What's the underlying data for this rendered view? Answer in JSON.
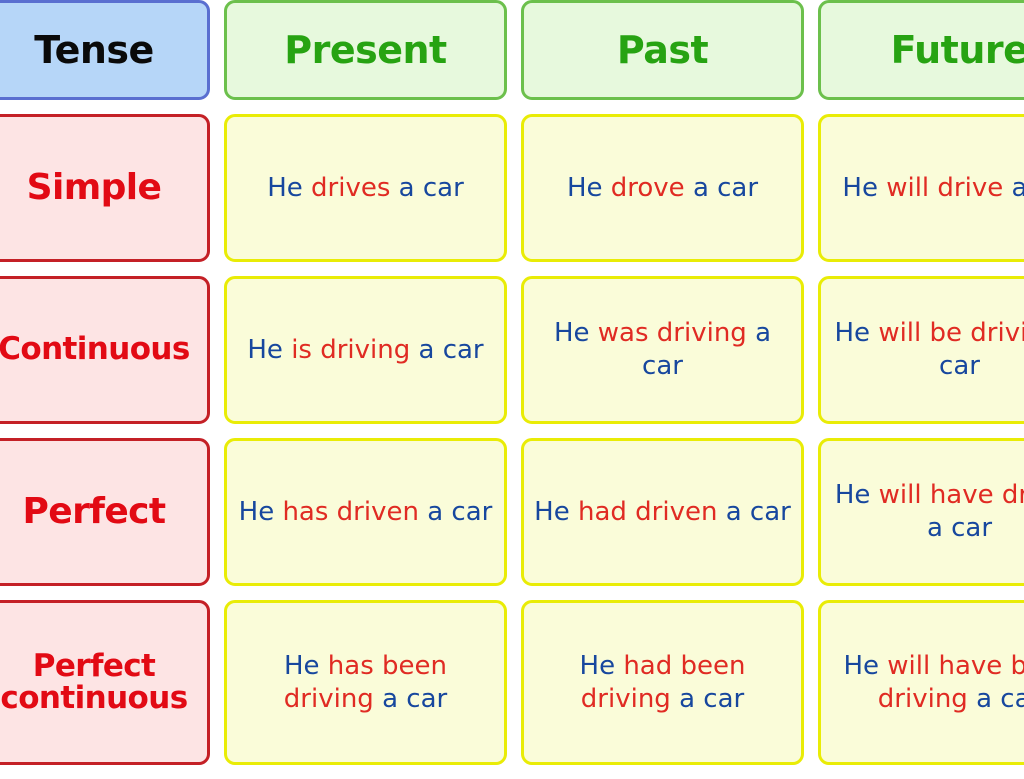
{
  "table": {
    "corner_label": "Tense",
    "columns": [
      "Present",
      "Past",
      "Future"
    ],
    "rows": [
      {
        "label": "Simple",
        "label_line2": "",
        "cells": [
          {
            "subject": "He ",
            "verb": "drives ",
            "object": "a car"
          },
          {
            "subject": "He ",
            "verb": "drove ",
            "object": "a car"
          },
          {
            "subject": "He ",
            "verb": "will drive ",
            "object": "a car"
          }
        ]
      },
      {
        "label": "Continuous",
        "label_line2": "",
        "cells": [
          {
            "subject": "He ",
            "verb": "is driving ",
            "object": "a car"
          },
          {
            "subject": "He ",
            "verb": "was driving ",
            "object": "a car"
          },
          {
            "subject": "He ",
            "verb": "will be driving ",
            "object": "a car"
          }
        ]
      },
      {
        "label": "Perfect",
        "label_line2": "",
        "cells": [
          {
            "subject": "He ",
            "verb": "has driven ",
            "object": "a car"
          },
          {
            "subject": "He ",
            "verb": "had driven ",
            "object": "a car"
          },
          {
            "subject": "He ",
            "verb": "will have driven ",
            "object": "a car"
          }
        ]
      },
      {
        "label": "Perfect",
        "label_line2": "continuous",
        "cells": [
          {
            "subject": "He ",
            "verb": "has been driving ",
            "object": "a car"
          },
          {
            "subject": "He ",
            "verb": "had been driving ",
            "object": "a car"
          },
          {
            "subject": "He ",
            "verb": "will have been driving ",
            "object": "a car"
          }
        ]
      }
    ]
  },
  "colors": {
    "corner_fill": "#b6d6f8",
    "corner_border": "#5a6fd0",
    "corner_text": "#0a0a0a",
    "column_head_fill": "#e7f9dd",
    "column_head_border": "#6cc04c",
    "column_head_text": "#27a312",
    "row_head_fill": "#fde4e4",
    "row_head_border": "#c42026",
    "row_head_text": "#e20a14",
    "sentence_fill": "#fafcd9",
    "sentence_border": "#e9ec06",
    "subject_text": "#17479e",
    "verb_text": "#e02b23",
    "object_text": "#17479e"
  }
}
